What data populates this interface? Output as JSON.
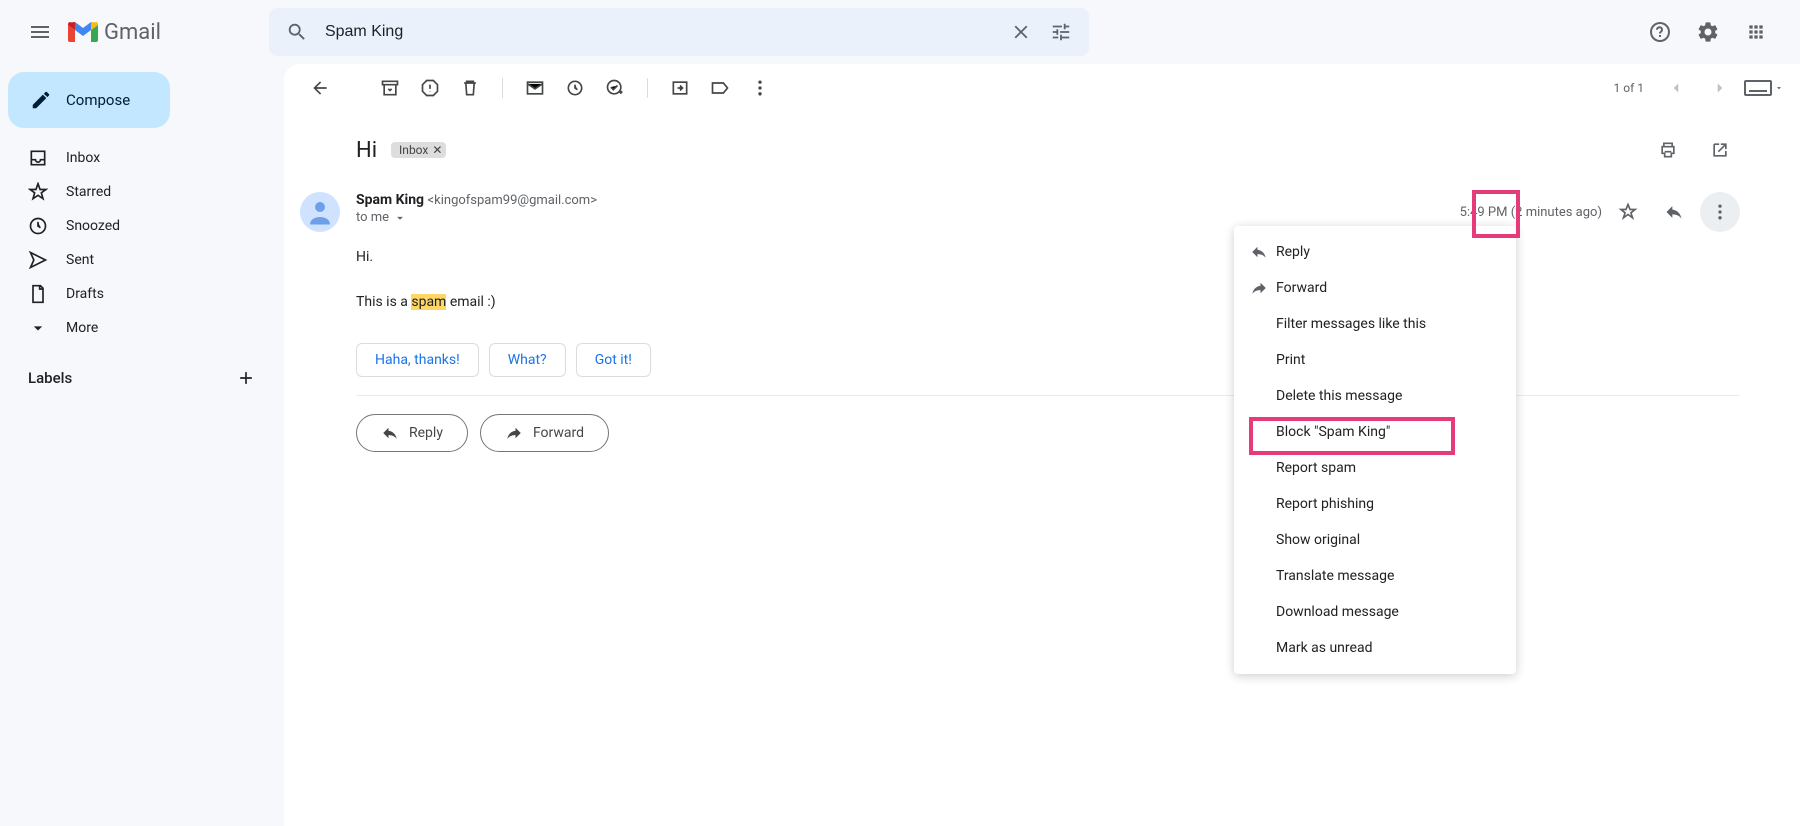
{
  "app": {
    "name": "Gmail"
  },
  "search": {
    "value": "Spam King"
  },
  "compose": {
    "label": "Compose"
  },
  "nav": {
    "inbox": "Inbox",
    "starred": "Starred",
    "snoozed": "Snoozed",
    "sent": "Sent",
    "drafts": "Drafts",
    "more": "More"
  },
  "labels": {
    "heading": "Labels"
  },
  "toolbar": {
    "page_count": "1 of 1"
  },
  "subject": {
    "text": "Hi",
    "label": "Inbox"
  },
  "sender": {
    "name": "Spam King",
    "email": "<kingofspam99@gmail.com>",
    "to": "to me"
  },
  "meta": {
    "time": "5:49 PM (2 minutes ago)"
  },
  "content": {
    "line1": "Hi.",
    "line2_a": "This is a ",
    "line2_hl": "spam",
    "line2_b": " email :)"
  },
  "smart_replies": {
    "r1": "Haha, thanks!",
    "r2": "What?",
    "r3": "Got it!"
  },
  "actions": {
    "reply": "Reply",
    "forward": "Forward"
  },
  "menu": {
    "reply": "Reply",
    "forward": "Forward",
    "filter": "Filter messages like this",
    "print": "Print",
    "delete": "Delete this message",
    "block": "Block \"Spam King\"",
    "report_spam": "Report spam",
    "report_phish": "Report phishing",
    "show_orig": "Show original",
    "translate": "Translate message",
    "download": "Download message",
    "unread": "Mark as unread"
  }
}
